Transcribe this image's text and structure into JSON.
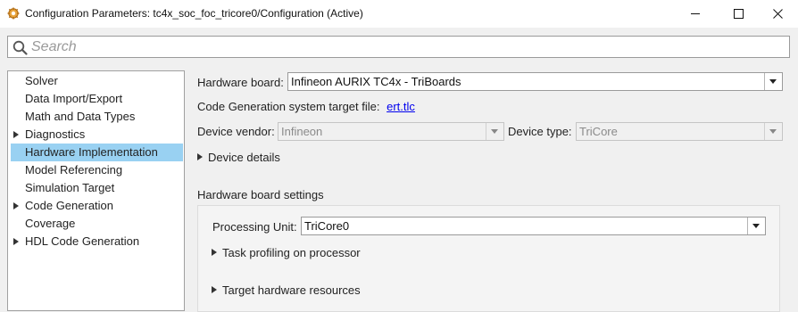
{
  "window": {
    "title": "Configuration Parameters: tc4x_soc_foc_tricore0/Configuration (Active)",
    "app_icon": "matlab-gear-icon",
    "controls": [
      "minimize-icon",
      "maximize-icon",
      "close-icon"
    ]
  },
  "search": {
    "placeholder": "Search",
    "value": ""
  },
  "tree": {
    "items": [
      {
        "label": "Solver",
        "expandable": false,
        "selected": false
      },
      {
        "label": "Data Import/Export",
        "expandable": false,
        "selected": false
      },
      {
        "label": "Math and Data Types",
        "expandable": false,
        "selected": false
      },
      {
        "label": "Diagnostics",
        "expandable": true,
        "selected": false
      },
      {
        "label": "Hardware Implementation",
        "expandable": false,
        "selected": true
      },
      {
        "label": "Model Referencing",
        "expandable": false,
        "selected": false
      },
      {
        "label": "Simulation Target",
        "expandable": false,
        "selected": false
      },
      {
        "label": "Code Generation",
        "expandable": true,
        "selected": false
      },
      {
        "label": "Coverage",
        "expandable": false,
        "selected": false
      },
      {
        "label": "HDL Code Generation",
        "expandable": true,
        "selected": false
      }
    ]
  },
  "main": {
    "hardware_board": {
      "label": "Hardware board:",
      "value": "Infineon AURIX TC4x - TriBoards"
    },
    "target_file": {
      "label": "Code Generation system target file:",
      "value": "ert.tlc"
    },
    "device_vendor": {
      "label": "Device vendor:",
      "value": "Infineon"
    },
    "device_type": {
      "label": "Device type:",
      "value": "TriCore"
    },
    "device_details": "Device details",
    "board_settings": {
      "title": "Hardware board settings",
      "processing_unit": {
        "label": "Processing Unit:",
        "value": "TriCore0"
      },
      "task_profiling": "Task profiling on processor",
      "target_resources": "Target hardware resources"
    }
  },
  "colors": {
    "selection": "#99d1f2",
    "link": "#0000ee"
  }
}
